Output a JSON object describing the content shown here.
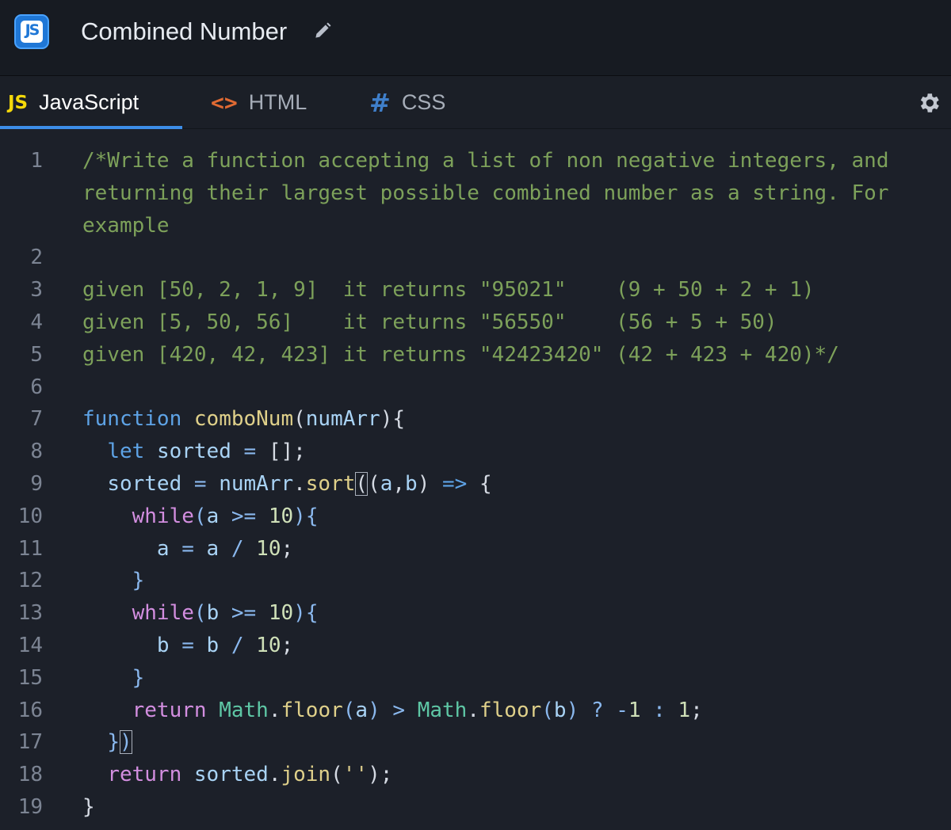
{
  "app": {
    "title": "Combined Number",
    "logo_icon": "js-logo-icon",
    "logo_text": "JS",
    "accent_color": "#3d8ee8"
  },
  "tabs": [
    {
      "icon_text": "JS",
      "label": "JavaScript",
      "active": true
    },
    {
      "icon_text": "<>",
      "label": "HTML",
      "active": false
    },
    {
      "icon_text": "#",
      "label": "CSS",
      "active": false
    }
  ],
  "editor": {
    "line_numbers": [
      "1",
      "2",
      "3",
      "4",
      "5",
      "6",
      "7",
      "8",
      "9",
      "10",
      "11",
      "12",
      "13",
      "14",
      "15",
      "16",
      "17",
      "18",
      "19"
    ],
    "lines": [
      "/*Write a function accepting a list of non negative integers, and returning their largest possible combined number as a string. For example",
      "",
      "given [50, 2, 1, 9]  it returns \"95021\"    (9 + 50 + 2 + 1)",
      "given [5, 50, 56]    it returns \"56550\"    (56 + 5 + 50)",
      "given [420, 42, 423] it returns \"42423420\" (42 + 423 + 420)*/",
      "",
      "function comboNum(numArr){",
      "  let sorted = [];",
      "  sorted = numArr.sort((a,b) => {",
      "    while(a >= 10){",
      "      a = a / 10;",
      "    }",
      "    while(b >= 10){",
      "      b = b / 10;",
      "    }",
      "    return Math.floor(a) > Math.floor(b) ? -1 : 1;",
      "  })",
      "  return sorted.join('');",
      "}"
    ]
  }
}
